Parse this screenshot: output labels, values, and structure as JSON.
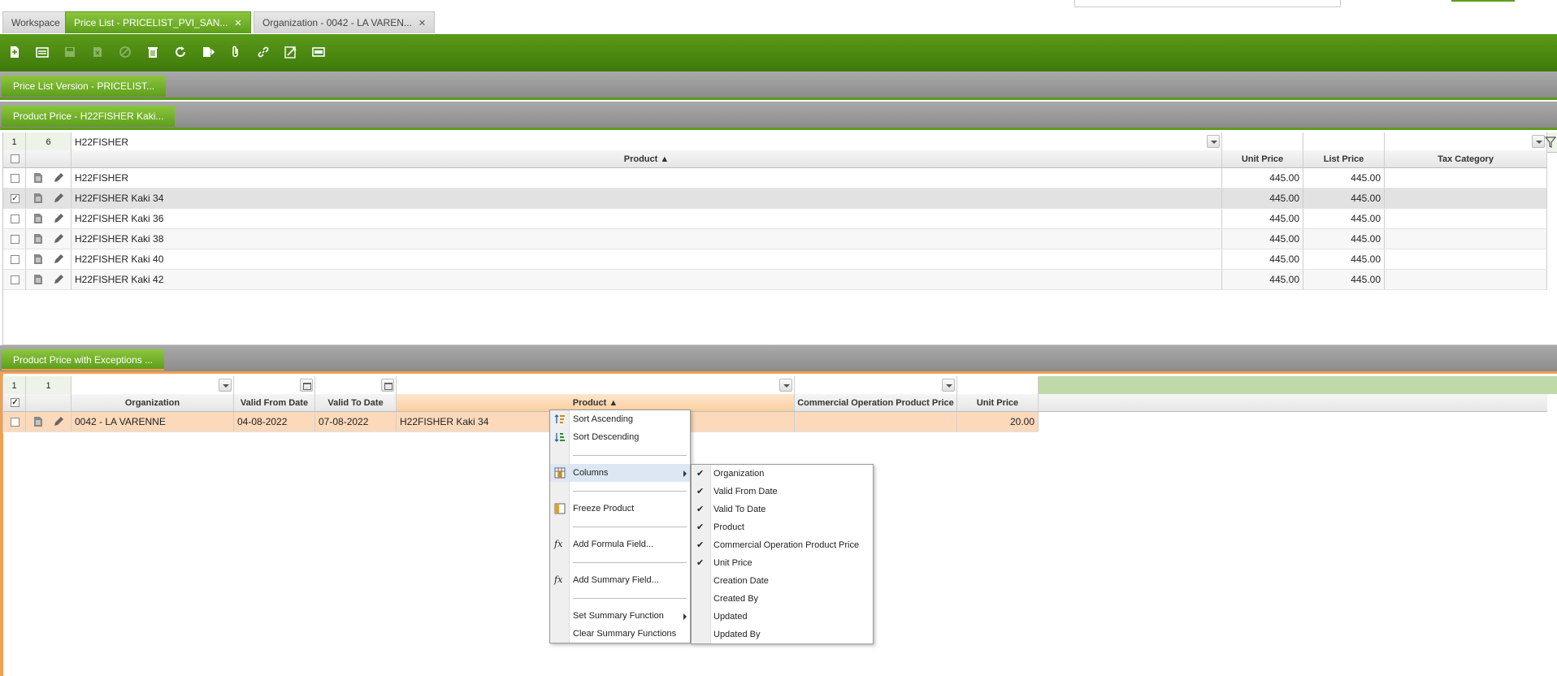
{
  "tabs": [
    {
      "label": "Workspace",
      "closable": false
    },
    {
      "label": "Price List - PRICELIST_PVI_SAN...",
      "closable": true,
      "active": true
    },
    {
      "label": "Organization - 0042 - LA VAREN...",
      "closable": true
    }
  ],
  "toolbar": {
    "buttons": [
      "new-document-icon",
      "new-record-icon",
      "save-icon",
      "undo-icon",
      "cancel-icon",
      "delete-icon",
      "refresh-icon",
      "export-icon",
      "attachment-icon",
      "link-icon",
      "tools-icon",
      "form-view-icon"
    ]
  },
  "sections": {
    "price_list_version": "Price List Version - PRICELIST...",
    "product_price": "Product Price - H22FISHER Kaki...",
    "exceptions": "Product Price with Exceptions ..."
  },
  "grid1": {
    "selected_count": "1",
    "total_count": "6",
    "product_filter": "H22FISHER",
    "headers": {
      "product": "Product ▲",
      "unit_price": "Unit Price",
      "list_price": "List Price",
      "tax_category": "Tax Category"
    },
    "rows": [
      {
        "product": "H22FISHER",
        "unit_price": "445.00",
        "list_price": "445.00",
        "checked": false
      },
      {
        "product": "H22FISHER Kaki 34",
        "unit_price": "445.00",
        "list_price": "445.00",
        "checked": true
      },
      {
        "product": "H22FISHER Kaki 36",
        "unit_price": "445.00",
        "list_price": "445.00",
        "checked": false
      },
      {
        "product": "H22FISHER Kaki 38",
        "unit_price": "445.00",
        "list_price": "445.00",
        "checked": false
      },
      {
        "product": "H22FISHER Kaki 40",
        "unit_price": "445.00",
        "list_price": "445.00",
        "checked": false
      },
      {
        "product": "H22FISHER Kaki 42",
        "unit_price": "445.00",
        "list_price": "445.00",
        "checked": false
      }
    ]
  },
  "grid2": {
    "selected_count": "1",
    "total_count": "1",
    "headers": {
      "organization": "Organization",
      "valid_from": "Valid From Date",
      "valid_to": "Valid To Date",
      "product": "Product ▲",
      "commercial": "Commercial Operation Product Price",
      "unit_price": "Unit Price"
    },
    "rows": [
      {
        "organization": "0042 - LA VARENNE",
        "valid_from": "04-08-2022",
        "valid_to": "07-08-2022",
        "product": "H22FISHER Kaki 34",
        "commercial": "",
        "unit_price": "20.00"
      }
    ]
  },
  "context_menu": {
    "sort_asc": "Sort Ascending",
    "sort_desc": "Sort Descending",
    "columns": "Columns",
    "freeze": "Freeze Product",
    "add_formula": "Add Formula Field...",
    "add_summary": "Add Summary Field...",
    "set_summary": "Set Summary Function",
    "clear_summary": "Clear Summary Functions"
  },
  "columns_menu": [
    {
      "label": "Organization",
      "checked": true
    },
    {
      "label": "Valid From Date",
      "checked": true
    },
    {
      "label": "Valid To Date",
      "checked": true
    },
    {
      "label": "Product",
      "checked": true
    },
    {
      "label": "Commercial Operation Product Price",
      "checked": true
    },
    {
      "label": "Unit Price",
      "checked": true
    },
    {
      "label": "Creation Date",
      "checked": false
    },
    {
      "label": "Created By",
      "checked": false
    },
    {
      "label": "Updated",
      "checked": false
    },
    {
      "label": "Updated By",
      "checked": false
    }
  ],
  "colors": {
    "green_accent": "#5d9e1b",
    "orange_accent": "#f0a050",
    "row_highlight": "#fcd9bb"
  }
}
